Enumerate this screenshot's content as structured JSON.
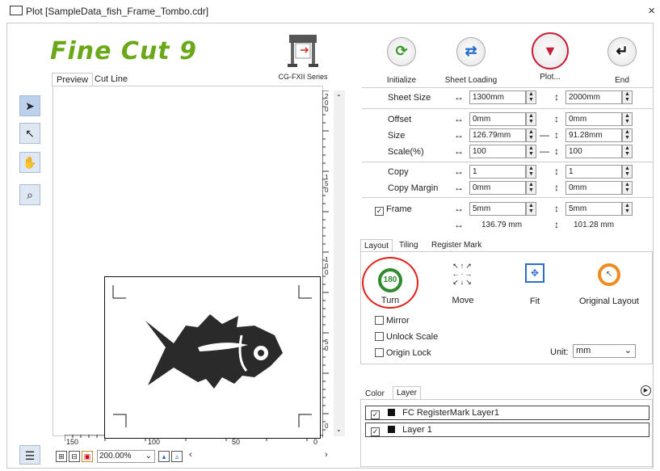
{
  "window": {
    "title": "Plot [SampleData_fish_Frame_Tombo.cdr]",
    "close": "×"
  },
  "logo": "Fine Cut 9",
  "device": {
    "name": "CG-FXII Series"
  },
  "preview_tabs": [
    "Preview",
    "Cut Line"
  ],
  "actions": [
    {
      "label": "Initialize",
      "icon": "refresh-icon"
    },
    {
      "label": "Sheet Loading",
      "icon": "swap-arrows-icon"
    },
    {
      "label": "Plot...",
      "icon": "plot-pen-icon"
    },
    {
      "label": "End",
      "icon": "return-arrow-icon"
    }
  ],
  "sheet": {
    "label": "Sheet Size",
    "width": "1300mm",
    "height": "2000mm"
  },
  "offset": {
    "label": "Offset",
    "x": "0mm",
    "y": "0mm"
  },
  "size": {
    "label": "Size",
    "x": "126.79mm",
    "y": "91.28mm"
  },
  "scale": {
    "label": "Scale(%)",
    "x": "100",
    "y": "100"
  },
  "copy": {
    "label": "Copy",
    "x": "1",
    "y": "1"
  },
  "copy_margin": {
    "label": "Copy Margin",
    "x": "0mm",
    "y": "0mm"
  },
  "frame": {
    "label": "Frame",
    "checked": true,
    "x": "5mm",
    "y": "5mm",
    "total_x": "136.79 mm",
    "total_y": "101.28 mm"
  },
  "layout_tabs": [
    "Layout",
    "Tiling",
    "Register Mark"
  ],
  "layout_buttons": [
    {
      "label": "Turn",
      "badge": "180"
    },
    {
      "label": "Move"
    },
    {
      "label": "Fit"
    },
    {
      "label": "Original Layout"
    }
  ],
  "options": {
    "mirror": "Mirror",
    "unlock_scale": "Unlock Scale",
    "origin_lock": "Origin Lock"
  },
  "unit": {
    "label": "Unit:",
    "value": "mm"
  },
  "layer_tabs": [
    "Color",
    "Layer"
  ],
  "layers": [
    {
      "name": "FC RegisterMark Layer1",
      "checked": true
    },
    {
      "name": "Layer 1",
      "checked": true
    }
  ],
  "zoom": "200.00%",
  "ruler": {
    "v_labels": [
      "2\n0\n0",
      "1\n5\n0",
      "1\n0\n0",
      "5\n0",
      "0"
    ],
    "h_labels": [
      "150",
      "100",
      "50",
      "0"
    ]
  },
  "colors": {
    "accent": "#6aa81a",
    "highlight": "#e0201a",
    "plot": "#c81e3a",
    "orange": "#f08a1e",
    "blue": "#2a6fc9"
  }
}
